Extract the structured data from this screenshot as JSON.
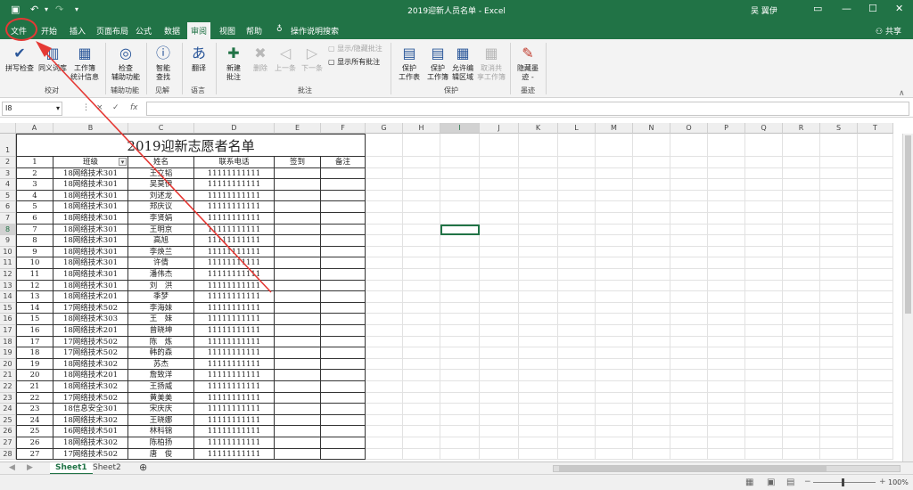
{
  "window": {
    "title": "2019迎新人员名单 - Excel",
    "user": "吴 翼伊",
    "buttons": [
      "restore-icon",
      "minimize-icon",
      "maximize-icon",
      "close-icon"
    ]
  },
  "menu": {
    "tabs": [
      "文件",
      "开始",
      "插入",
      "页面布局",
      "公式",
      "数据",
      "审阅",
      "视图",
      "帮助"
    ],
    "active": "审阅",
    "tellme": "操作说明搜索",
    "share": "共享"
  },
  "ribbon": {
    "groups": [
      {
        "label": "校对",
        "buttons": [
          "拼写检查",
          "同义词库",
          "工作簿\n统计信息"
        ]
      },
      {
        "label": "辅助功能",
        "buttons": [
          "检查\n辅助功能"
        ]
      },
      {
        "label": "见解",
        "buttons": [
          "智能\n查找"
        ]
      },
      {
        "label": "语言",
        "buttons": [
          "翻译"
        ]
      },
      {
        "label": "批注",
        "buttons": [
          "新建\n批注",
          "删除",
          "上一条",
          "下一条"
        ],
        "small": [
          "显示/隐藏批注",
          "显示所有批注"
        ]
      },
      {
        "label": "保护",
        "buttons": [
          "保护\n工作表",
          "保护\n工作簿",
          "允许编\n辑区域",
          "取消共\n享工作簿"
        ]
      },
      {
        "label": "墨迹",
        "buttons": [
          "隐藏墨\n迹 -"
        ]
      }
    ]
  },
  "formula_bar": {
    "cell_ref": "I8",
    "fx": "fx",
    "cancel": "×",
    "enter": "✓"
  },
  "grid": {
    "columns": [
      "A",
      "B",
      "C",
      "D",
      "E",
      "F",
      "G",
      "H",
      "I",
      "J",
      "K",
      "L",
      "M",
      "N",
      "O",
      "P",
      "Q",
      "R",
      "S",
      "T"
    ],
    "row_numbers": [
      "1",
      "2",
      "3",
      "4",
      "5",
      "6",
      "7",
      "8",
      "9",
      "10",
      "11",
      "12",
      "13",
      "14",
      "15",
      "16",
      "17",
      "18",
      "19",
      "20",
      "21",
      "22",
      "23",
      "24",
      "25",
      "26",
      "27",
      "28"
    ],
    "table_title": "2019迎新志愿者名单",
    "headers": [
      "1",
      "班级",
      "姓名",
      "联系电话",
      "签到",
      "备注"
    ],
    "rows": [
      [
        "2",
        "18网络技术301",
        "王立韬",
        "11111111111",
        "",
        ""
      ],
      [
        "3",
        "18网络技术301",
        "吴莫伊",
        "11111111111",
        "",
        ""
      ],
      [
        "4",
        "18网络技术301",
        "刘述龙",
        "11111111111",
        "",
        ""
      ],
      [
        "5",
        "18网络技术301",
        "郑庆议",
        "11111111111",
        "",
        ""
      ],
      [
        "6",
        "18网络技术301",
        "李贤娟",
        "11111111111",
        "",
        ""
      ],
      [
        "7",
        "18网络技术301",
        "王明京",
        "11111111111",
        "",
        ""
      ],
      [
        "8",
        "18网络技术301",
        "高旭",
        "11111111111",
        "",
        ""
      ],
      [
        "9",
        "18网络技术301",
        "李焕兰",
        "11111111111",
        "",
        ""
      ],
      [
        "10",
        "18网络技术301",
        "许倩",
        "11111111111",
        "",
        ""
      ],
      [
        "11",
        "18网络技术301",
        "潘伟杰",
        "11111111111",
        "",
        ""
      ],
      [
        "12",
        "18网络技术301",
        "刘　洪",
        "11111111111",
        "",
        ""
      ],
      [
        "13",
        "18网络技术201",
        "季梦",
        "11111111111",
        "",
        ""
      ],
      [
        "14",
        "17网络技术502",
        "李海妹",
        "11111111111",
        "",
        ""
      ],
      [
        "15",
        "18网络技术303",
        "王　妹",
        "11111111111",
        "",
        ""
      ],
      [
        "16",
        "18网络技术201",
        "曾晓坤",
        "11111111111",
        "",
        ""
      ],
      [
        "17",
        "17网络技术502",
        "陈　炼",
        "11111111111",
        "",
        ""
      ],
      [
        "18",
        "17网络技术502",
        "韩的森",
        "11111111111",
        "",
        ""
      ],
      [
        "19",
        "18网络技术302",
        "苏杰",
        "11111111111",
        "",
        ""
      ],
      [
        "20",
        "18网络技术201",
        "詹致洋",
        "11111111111",
        "",
        ""
      ],
      [
        "21",
        "18网络技术302",
        "王扬威",
        "11111111111",
        "",
        ""
      ],
      [
        "22",
        "17网络技术502",
        "黄美美",
        "11111111111",
        "",
        ""
      ],
      [
        "23",
        "18信息安全301",
        "宋庆庆",
        "11111111111",
        "",
        ""
      ],
      [
        "24",
        "18网络技术302",
        "王晓娜",
        "11111111111",
        "",
        ""
      ],
      [
        "25",
        "16网络技术501",
        "林科锦",
        "11111111111",
        "",
        ""
      ],
      [
        "26",
        "18网络技术302",
        "陈柏扬",
        "11111111111",
        "",
        ""
      ],
      [
        "27",
        "17网络技术502",
        "唐　俊",
        "11111111111",
        "",
        ""
      ]
    ]
  },
  "sheets": [
    "Sheet1",
    "Sheet2"
  ],
  "active_sheet": "Sheet1",
  "status": {
    "zoom": "100%"
  }
}
